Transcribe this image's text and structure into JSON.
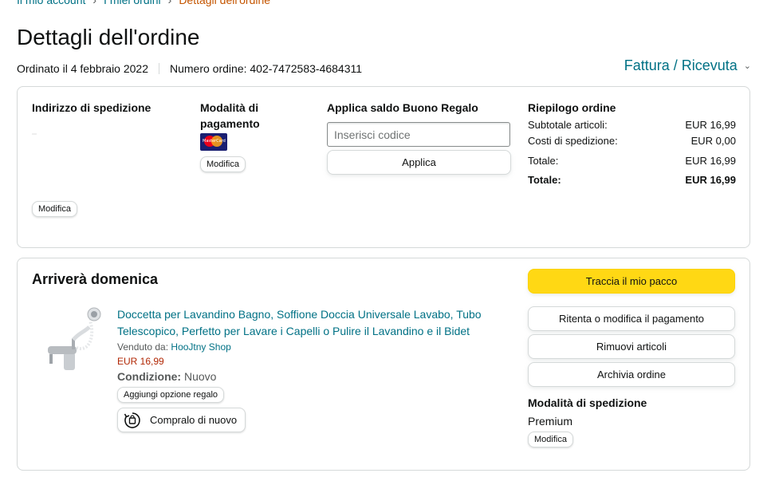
{
  "breadcrumb": {
    "account": "Il mio account",
    "orders": "I miei ordini",
    "current": "Dettagli dell'ordine"
  },
  "page_title": "Dettagli dell'ordine",
  "order_meta": {
    "ordered_on": "Ordinato il 4 febbraio 2022",
    "order_number": "Numero ordine: 402-7472583-4684311"
  },
  "invoice_link": "Fattura / Ricevuta",
  "shipping_address": {
    "title": "Indirizzo di spedizione",
    "modify_label": "Modifica"
  },
  "payment": {
    "title": "Modalità di pagamento",
    "card_brand": "MasterCard",
    "modify_label": "Modifica"
  },
  "gift_card": {
    "title": "Applica saldo Buono Regalo",
    "placeholder": "Inserisci codice",
    "apply_label": "Applica"
  },
  "summary": {
    "title": "Riepilogo ordine",
    "rows": [
      {
        "label": "Subtotale articoli:",
        "value": "EUR 16,99"
      },
      {
        "label": "Costi di spedizione:",
        "value": "EUR 0,00"
      },
      {
        "label": "Totale:",
        "value": "EUR 16,99"
      },
      {
        "label": "Totale:",
        "value": "EUR 16,99"
      }
    ]
  },
  "shipment": {
    "arrival": "Arriverà domenica",
    "product_title": "Doccetta per Lavandino Bagno, Soffione Doccia Universale Lavabo, Tubo Telescopico, Perfetto per Lavare i Capelli o Pulire il Lavandino e il Bidet",
    "sold_by_label": "Venduto da:",
    "seller": "HooJtny Shop",
    "price": "EUR 16,99",
    "condition_label": "Condizione:",
    "condition_value": "Nuovo",
    "gift_option_label": "Aggiungi opzione regalo",
    "buy_again_label": "Compralo di nuovo"
  },
  "actions": {
    "track": "Traccia il mio pacco",
    "retry_payment": "Ritenta o modifica il pagamento",
    "remove_items": "Rimuovi articoli",
    "archive": "Archivia ordine"
  },
  "shipping_method": {
    "title": "Modalità di spedizione",
    "value": "Premium",
    "modify_label": "Modifica"
  },
  "colors": {
    "link": "#007185",
    "price": "#b12704",
    "track_button": "#ffd814",
    "breadcrumb_current": "#c45500"
  }
}
